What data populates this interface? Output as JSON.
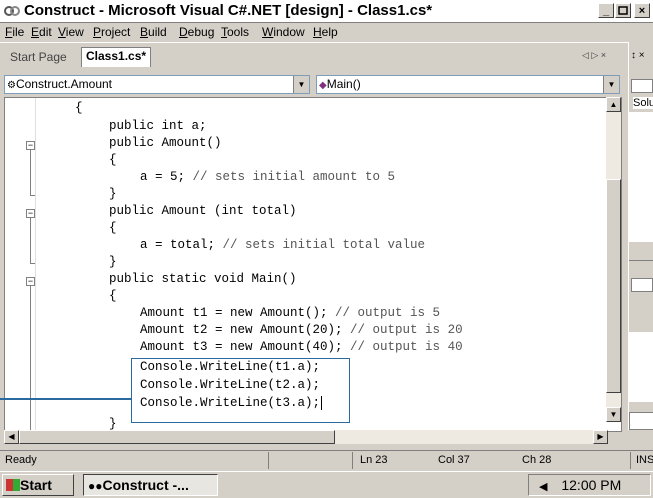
{
  "window": {
    "title": "Construct - Microsoft Visual C#.NET [design] - Class1.cs*",
    "min_label": "_",
    "max_label": "·",
    "close_label": "×"
  },
  "menu": {
    "items": [
      {
        "label": "File",
        "key": "F",
        "rest": "ile"
      },
      {
        "label": "Edit",
        "key": "E",
        "rest": "dit"
      },
      {
        "label": "View",
        "key": "V",
        "rest": "iew"
      },
      {
        "label": "Project",
        "key": "P",
        "rest": "roject"
      },
      {
        "label": "Build",
        "key": "B",
        "rest": "uild"
      },
      {
        "label": "Debug",
        "key": "D",
        "rest": "ebug"
      },
      {
        "label": "Tools",
        "key": "T",
        "rest": "ools"
      },
      {
        "label": "Window",
        "key": "W",
        "rest": "indow"
      },
      {
        "label": "Help",
        "key": "H",
        "rest": "elp"
      }
    ]
  },
  "tabs": {
    "start_page": "Start Page",
    "active": "Class1.cs*",
    "nav": "◁ ▷ ×"
  },
  "selectors": {
    "class_value": "Construct.Amount",
    "member_value": "Main()"
  },
  "code": {
    "lines": [
      {
        "text": "{"
      },
      {
        "text": "public int a;"
      },
      {
        "text": "public Amount()"
      },
      {
        "text": "{"
      },
      {
        "text": "a = 5;",
        "comment": " // sets initial amount to 5"
      },
      {
        "text": "}"
      },
      {
        "text": "public Amount (int total)"
      },
      {
        "text": "{"
      },
      {
        "text": "a = total;",
        "comment": " // sets initial total value"
      },
      {
        "text": "}"
      },
      {
        "text": "public static void Main()"
      },
      {
        "text": "{"
      },
      {
        "text": "Amount t1 = new Amount();",
        "comment": " // output is 5"
      },
      {
        "text": "Amount t2 = new Amount(20);",
        "comment": " // output is 20"
      },
      {
        "text": "Amount t3 = new Amount(40);",
        "comment": " // output is 40"
      },
      {
        "text": "Console.WriteLine(t1.a);"
      },
      {
        "text": "Console.WriteLine(t2.a);"
      },
      {
        "text": "Console.WriteLine(t3.a);"
      },
      {
        "text": "}"
      }
    ]
  },
  "right_panel": {
    "solution_label": "Solu",
    "pin": "↕ ×"
  },
  "status": {
    "ready": "Ready",
    "ln": "Ln 23",
    "col": "Col 37",
    "ch": "Ch 28",
    "ins": "INS"
  },
  "taskbar": {
    "start": "Start",
    "task": "Construct -...",
    "clock": "12:00 PM"
  },
  "colors": {
    "highlight_box": "#2a6aa0"
  }
}
